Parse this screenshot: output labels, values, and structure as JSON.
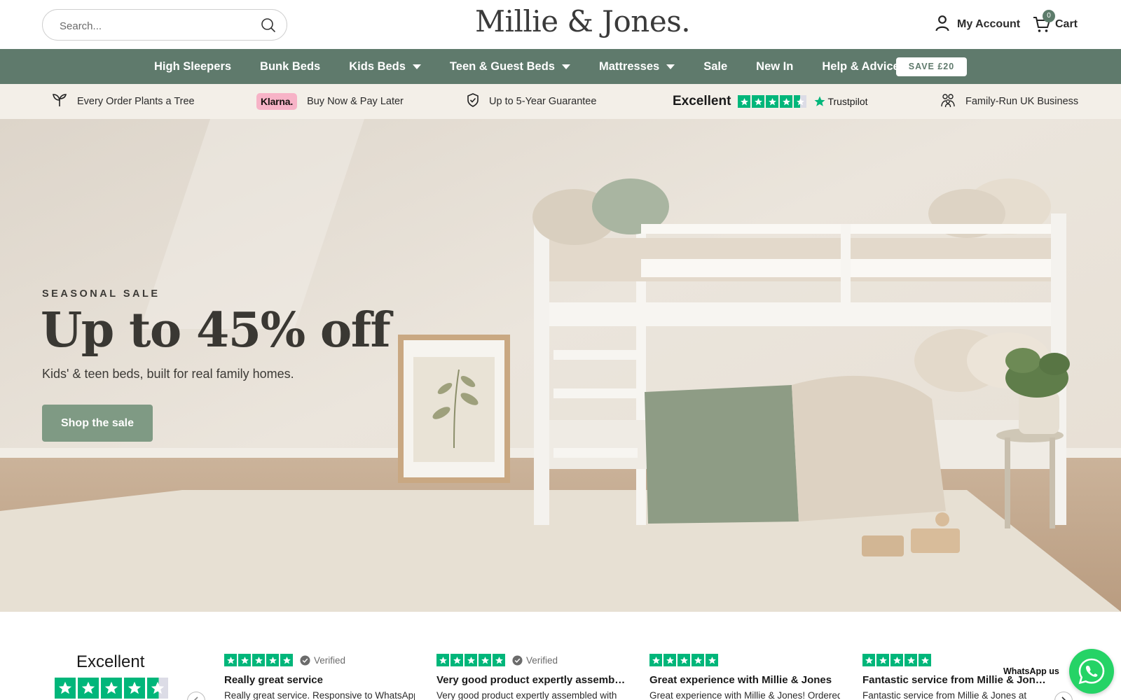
{
  "header": {
    "search_placeholder": "Search...",
    "logo_text": "Millie & Jones.",
    "account_label": "My Account",
    "cart_label": "Cart",
    "cart_count": "0"
  },
  "nav": {
    "items": [
      {
        "label": "High Sleepers",
        "has_dropdown": false
      },
      {
        "label": "Bunk Beds",
        "has_dropdown": false
      },
      {
        "label": "Kids Beds",
        "has_dropdown": true
      },
      {
        "label": "Teen & Guest Beds",
        "has_dropdown": true
      },
      {
        "label": "Mattresses",
        "has_dropdown": true
      },
      {
        "label": "Sale",
        "has_dropdown": false
      },
      {
        "label": "New In",
        "has_dropdown": false
      },
      {
        "label": "Help & Advice",
        "has_dropdown": true
      }
    ],
    "save_label": "SAVE £20"
  },
  "usp": {
    "tree": "Every Order Plants a Tree",
    "klarna_badge": "Klarna.",
    "klarna_text": "Buy Now & Pay Later",
    "guarantee": "Up to 5-Year Guarantee",
    "trustpilot_rating": "Excellent",
    "trustpilot_brand": "Trustpilot",
    "family": "Family-Run UK Business"
  },
  "hero": {
    "kicker": "SEASONAL SALE",
    "title": "Up to 45% off",
    "subtitle": "Kids' & teen beds, built for real family homes.",
    "cta": "Shop the sale"
  },
  "reviews": {
    "summary_rating": "Excellent",
    "cards": [
      {
        "verified": "Verified",
        "title": "Really great service",
        "body": "Really great service. Responsive to WhatsApp"
      },
      {
        "verified": "Verified",
        "title": "Very good product expertly assemble...",
        "body": "Very good product expertly assembled with"
      },
      {
        "verified": "",
        "title": "Great experience with Millie & Jones",
        "body": "Great experience with Millie & Jones! Ordered"
      },
      {
        "verified": "",
        "title": "Fantastic service from Millie & Jones...",
        "body": "Fantastic service from Millie & Jones at"
      }
    ]
  },
  "whatsapp": {
    "label": "WhatsApp us"
  },
  "colors": {
    "nav_green": "#5f7a6c",
    "cta_green": "#7f9a84",
    "trustpilot_green": "#00b67a",
    "usp_bg": "#f3efe8",
    "klarna_pink": "#f7b3c7",
    "whatsapp_green": "#25d366"
  }
}
